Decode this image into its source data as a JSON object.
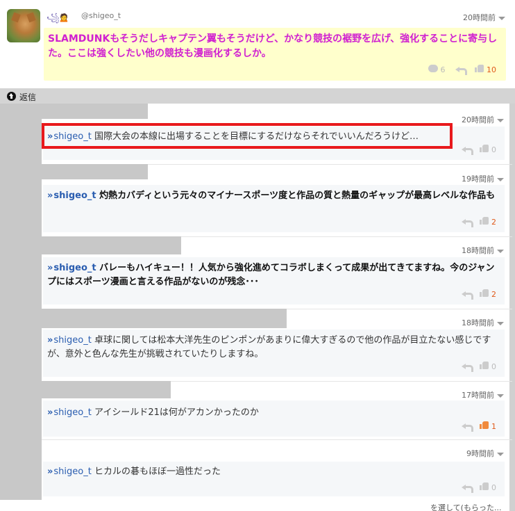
{
  "main_post": {
    "user_deco": "꧁🙍",
    "handle": "@shigeo_t",
    "time": "20時間前",
    "text": "SLAMDUNKもそうだしキャプテン翼もそうだけど、かなり競技の裾野を広げ、強化することに寄与した。ここは強くしたい他の競技も漫画化するしか。",
    "comments": "6",
    "likes": "10"
  },
  "reply_header": {
    "label": "返信"
  },
  "replies": [
    {
      "time": "20時間前",
      "mention_arrows": "»",
      "mention": "shigeo_t",
      "text": "国際大会の本線に出場することを目標にするだけならそれでいいんだろうけど…",
      "likes": "0"
    },
    {
      "time": "19時間前",
      "mention_arrows": "»",
      "mention": "shigeo_t",
      "text": "灼熱カバディという元々のマイナースポーツ度と作品の質と熱量のギャップが最高レベルな作品も",
      "likes": "2"
    },
    {
      "time": "18時間前",
      "mention_arrows": "»",
      "mention": "shigeo_t",
      "text": "バレーもハイキュー！！人気から強化進めてコラボしまくって成果が出てきてますね。今のジャンプにはスポーツ漫画と言える作品がないのが残念･･･",
      "likes": "2"
    },
    {
      "time": "18時間前",
      "mention_arrows": "»",
      "mention": "shigeo_t",
      "text": "卓球に関しては松本大洋先生のピンポンがあまりに偉大すぎるので他の作品が目立たない感じですが、意外と色んな先生が挑戦されていたりしますね。",
      "likes": "0"
    },
    {
      "time": "17時間前",
      "mention_arrows": "»",
      "mention": "shigeo_t",
      "text": "アイシールド21は何がアカンかったのか",
      "likes": "1"
    },
    {
      "time": "9時間前",
      "mention_arrows": "»",
      "mention": "shigeo_t",
      "text": "ヒカルの碁もほぼ一過性だった",
      "likes": "0"
    }
  ],
  "footer": {
    "partial_text": "を選して(もらった..."
  },
  "colors": {
    "main_text": "#d020d0",
    "highlight_border": "#e8191c",
    "mention": "#2a5db0",
    "like_active": "#f08a3c"
  },
  "icons": [
    "reply-arrow-icon",
    "thumbs-up-icon",
    "comment-icon",
    "chevron-down-icon",
    "arrow-up-circle-icon"
  ]
}
